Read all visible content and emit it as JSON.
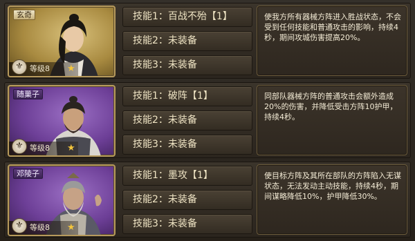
{
  "heroes": [
    {
      "name": "玄奇",
      "theme": "gold",
      "level": "等级8",
      "skills": [
        "技能1：百战不殆【1】",
        "技能2：未装备",
        "技能3：未装备"
      ],
      "description": "使我方所有器械方阵进入胜战状态，不会受到任何技能和普通攻击的影响，持续4秒，期间攻城伤害提高20%。"
    },
    {
      "name": "随巢子",
      "theme": "purple",
      "level": "等级8",
      "skills": [
        "技能1：破阵【1】",
        "技能2：未装备",
        "技能3：未装备"
      ],
      "description": "同部队器械方阵的普通攻击会额外造成20%的伤害，并降低受击方阵10护甲，持续4秒。"
    },
    {
      "name": "邓陵子",
      "theme": "purple",
      "level": "等级8",
      "skills": [
        "技能1：墨攻【1】",
        "技能2：未装备",
        "技能3：未装备"
      ],
      "description": "使目标方阵及其所在部队的方阵陷入无谋状态，无法发动主动技能，持续4秒，期间谋略降低10%，护甲降低30%。"
    }
  ],
  "icons": {
    "level_badge": "scroll-emblem-icon",
    "rank": "star-icon"
  },
  "colors": {
    "star": "#f3c53c",
    "gold_card": "#c9a85a",
    "purple_card": "#6d3f97"
  }
}
